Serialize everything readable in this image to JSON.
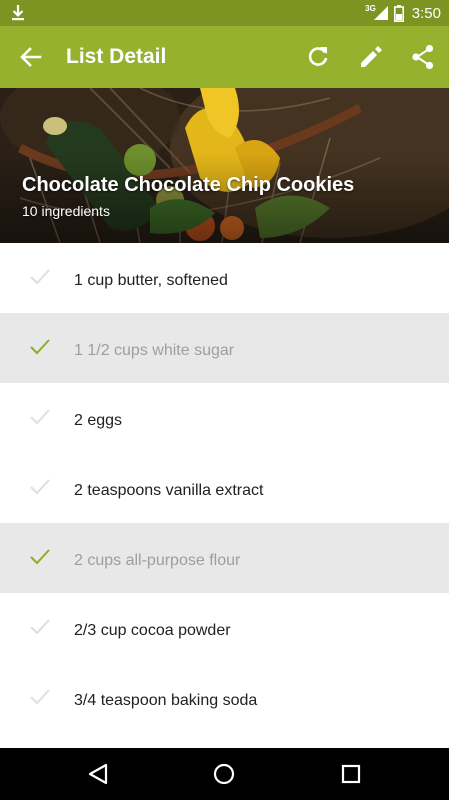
{
  "status_bar": {
    "network": "3G",
    "time": "3:50",
    "icons": [
      "download-icon",
      "signal-icon",
      "battery-icon"
    ]
  },
  "app_bar": {
    "title": "List Detail",
    "icons": [
      "back-arrow-icon",
      "refresh-icon",
      "edit-icon",
      "share-icon"
    ]
  },
  "hero": {
    "title": "Chocolate Chocolate Chip Cookies",
    "subtitle": "10 ingredients"
  },
  "ingredients": [
    {
      "text": "1 cup butter, softened",
      "checked": false
    },
    {
      "text": "1 1/2 cups white sugar",
      "checked": true
    },
    {
      "text": "2 eggs",
      "checked": false
    },
    {
      "text": "2 teaspoons vanilla extract",
      "checked": false
    },
    {
      "text": "2 cups all-purpose flour",
      "checked": true
    },
    {
      "text": "2/3 cup cocoa powder",
      "checked": false
    },
    {
      "text": "3/4 teaspoon baking soda",
      "checked": false
    }
  ],
  "colors": {
    "status_bar": "#7d9422",
    "app_bar": "#95b12e",
    "check_active": "#8bad2b",
    "check_inactive": "#dedede",
    "checked_row_bg": "#e8e8e8"
  },
  "nav_bar": {
    "icons": [
      "nav-back-icon",
      "nav-home-icon",
      "nav-recents-icon"
    ]
  }
}
